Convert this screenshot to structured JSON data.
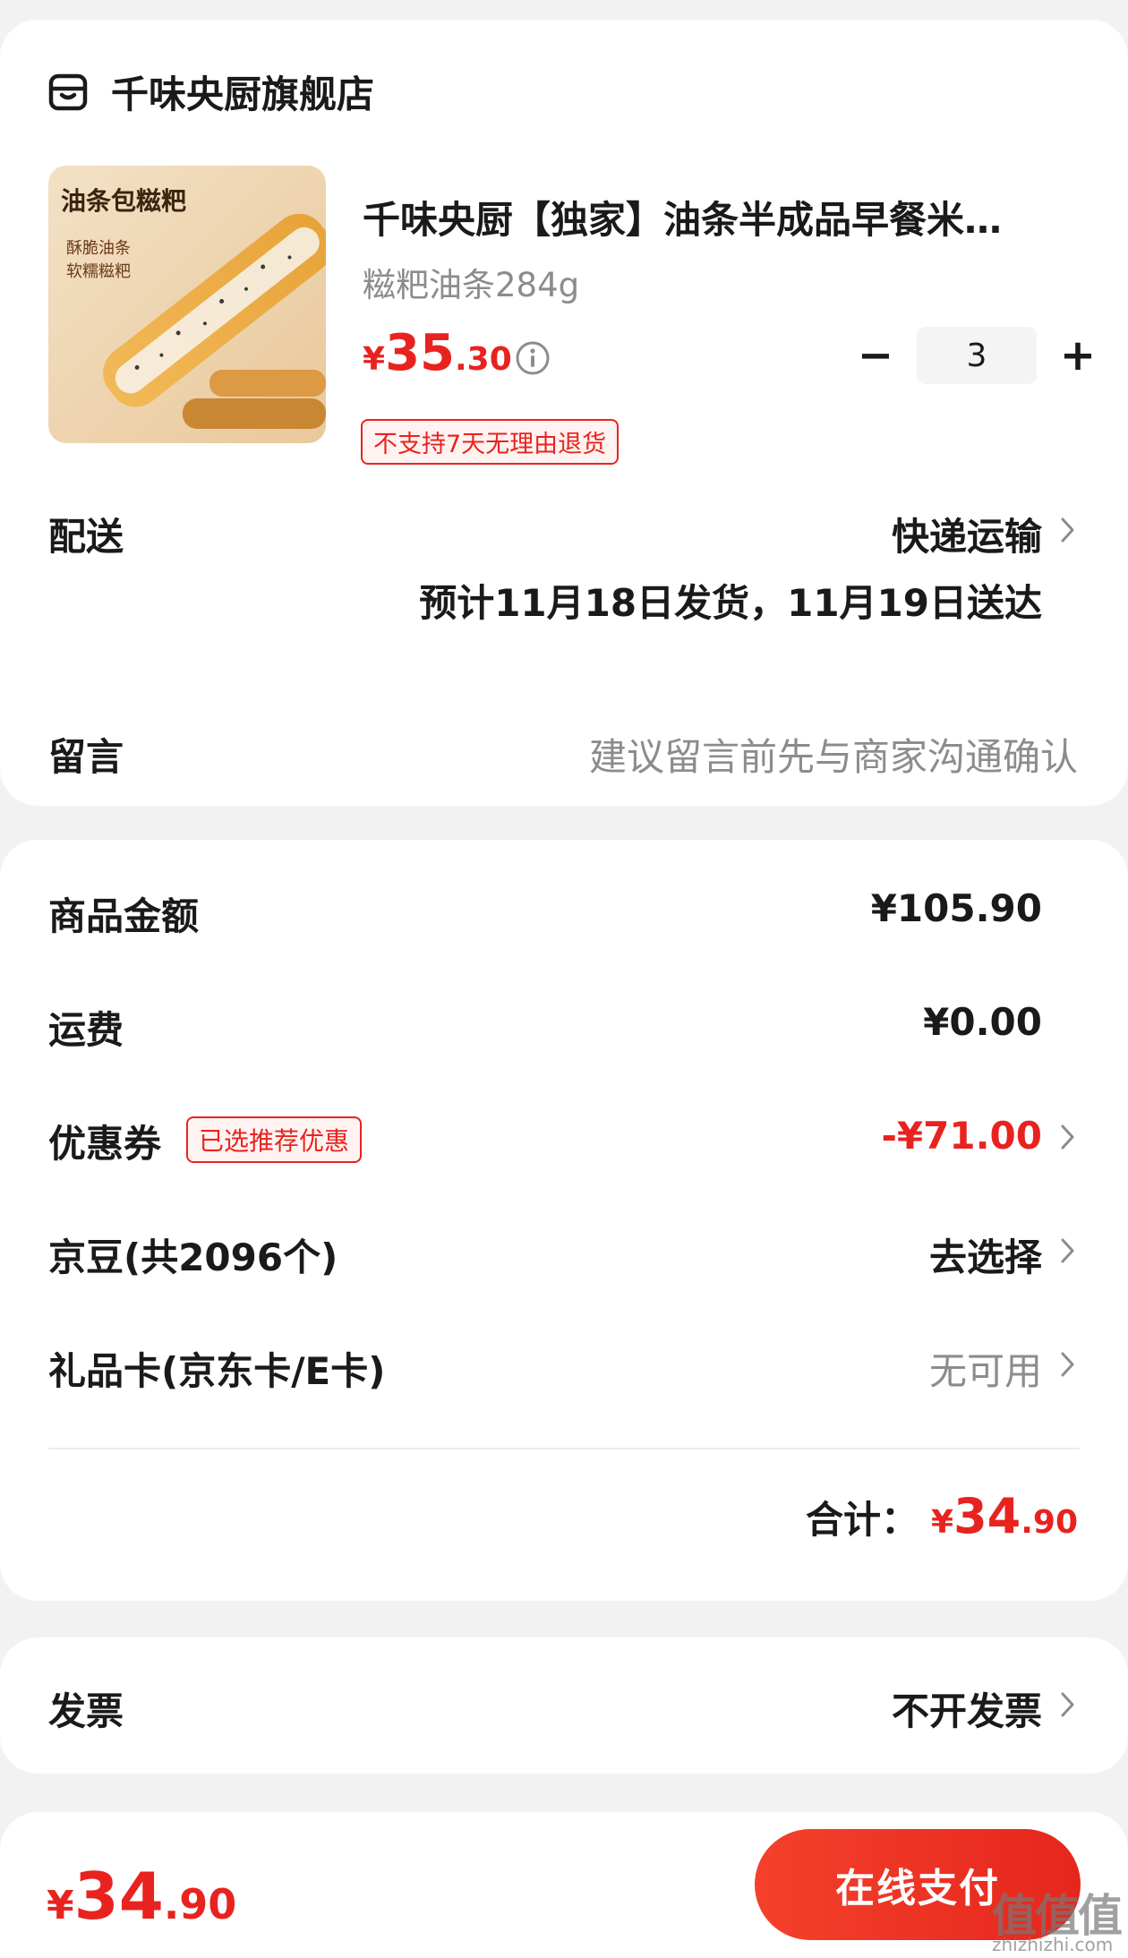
{
  "shop": {
    "name": "千味央厨旗舰店",
    "icon": "shop-icon"
  },
  "product": {
    "image_text_main": "油条包糍粑",
    "image_text_line1": "酥脆油条",
    "image_text_line2": "软糯糍粑",
    "title": "千味央厨【独家】油条半成品早餐米…",
    "spec": "糍粑油条284g",
    "price_symbol": "¥",
    "price_int": "35",
    "price_dec": ".30",
    "qty_minus": "−",
    "quantity": "3",
    "qty_plus": "+",
    "return_tag": "不支持7天无理由退货"
  },
  "delivery": {
    "label": "配送",
    "method": "快递运输",
    "note": "预计11月18日发货，11月19日送达"
  },
  "message": {
    "label": "留言",
    "placeholder": "建议留言前先与商家沟通确认"
  },
  "summary": {
    "goods_label": "商品金额",
    "goods_value": "¥105.90",
    "shipping_label": "运费",
    "shipping_value": "¥0.00",
    "coupon_label": "优惠券",
    "coupon_tag": "已选推荐优惠",
    "coupon_value": "-¥71.00",
    "beans_label": "京豆(共2096个)",
    "beans_value": "去选择",
    "giftcard_label": "礼品卡(京东卡/E卡)",
    "giftcard_value": "无可用",
    "total_label": "合计：",
    "total_symbol": "¥",
    "total_int": "34",
    "total_dec": ".90"
  },
  "invoice": {
    "label": "发票",
    "value": "不开发票"
  },
  "bottom": {
    "price_symbol": "¥",
    "price_int": "34",
    "price_dec": ".90",
    "pay_label": "在线支付"
  },
  "watermark": {
    "big": "值值值",
    "small": "zhizhizhi.com"
  },
  "colors": {
    "accent": "#e8231f",
    "background": "#f2f2f2",
    "card": "#ffffff",
    "muted": "#8c8c8c"
  }
}
